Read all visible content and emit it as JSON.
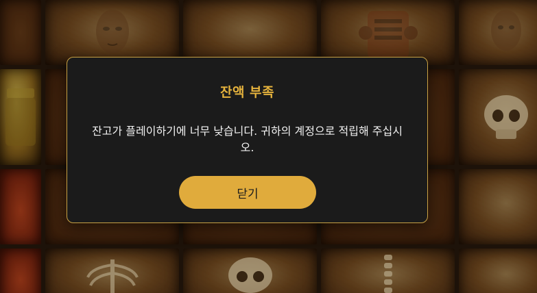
{
  "modal": {
    "title": "잔액 부족",
    "message": "잔고가 플레이하기에 너무 낮습니다. 귀하의 계정으로 적립해 주십시오.",
    "close_label": "닫기"
  },
  "colors": {
    "accent": "#e0ab3c",
    "title": "#e6b33d",
    "modal_bg": "#1b1b1b",
    "modal_border": "#c9a345",
    "text": "#f2f2f2"
  },
  "background": {
    "tiles": [
      "reel-tile",
      "face-icon",
      "tile",
      "masked-face-icon",
      "face-icon",
      "jar-icon",
      "tile",
      "tile",
      "tile",
      "skull-icon",
      "reel-tile",
      "tile",
      "tile",
      "tile",
      "tile",
      "reel-tile",
      "ribcage-icon",
      "skull-icon",
      "spine-icon",
      "tile"
    ]
  }
}
